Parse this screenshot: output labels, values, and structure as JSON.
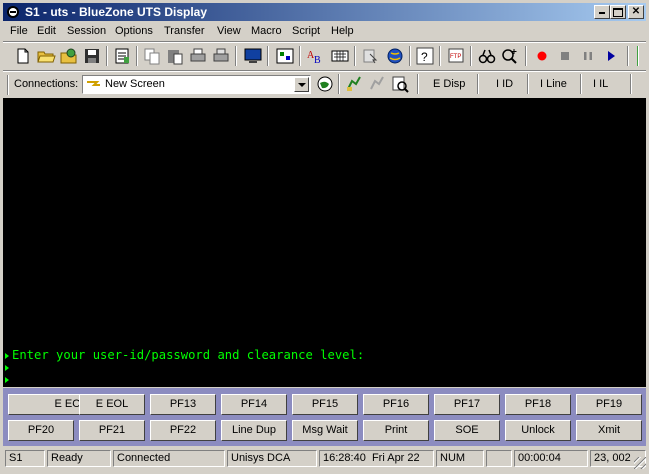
{
  "window": {
    "title": "S1 - uts - BlueZone UTS Display",
    "icon": "s1-app-icon",
    "controls": [
      "minimize-icon",
      "maximize-icon",
      "close-icon"
    ]
  },
  "menu": [
    "File",
    "Edit",
    "Session",
    "Options",
    "Transfer",
    "View",
    "Macro",
    "Script",
    "Help"
  ],
  "toolbar": {
    "icons": [
      "new-document-icon",
      "open-folder-icon",
      "settings-folder-icon",
      "save-icon",
      "notepad-icon",
      "copy-icon",
      "paste-icon",
      "print-icon",
      "print-setup-icon",
      "display-icon",
      "keyboard-map-icon",
      "font-icon",
      "keypad-icon",
      "hotspot-icon",
      "globe-icon",
      "help-icon",
      "ftp-icon",
      "binoculars-icon",
      "zoom-icon",
      "record-icon",
      "stop-icon",
      "pause-icon",
      "play-icon"
    ],
    "colors": {
      "record": "#ff0000",
      "play": "#0000a0",
      "stop": "#808080"
    }
  },
  "connections": {
    "label": "Connections:",
    "selected": "New Screen",
    "fkeys": [
      "E Disp",
      "I ID",
      "I Line",
      "I IL"
    ]
  },
  "terminal": {
    "lines": [
      "Enter your user-id/password and clearance level:",
      "",
      ""
    ],
    "text_color": "#00ff00",
    "background": "#000000"
  },
  "function_keys": {
    "row1": [
      "E EOF",
      "E EOL",
      "PF13",
      "PF14",
      "PF15",
      "PF16",
      "PF17",
      "PF18",
      "PF19"
    ],
    "row2": [
      "PF20",
      "PF21",
      "PF22",
      "Line Dup",
      "Msg Wait",
      "Print",
      "SOE",
      "Unlock",
      "Xmit"
    ],
    "panel_color": "#8c8cc0"
  },
  "status": {
    "session": "S1",
    "state": "Ready",
    "connection": "Connected",
    "host": "Unisys DCA",
    "time": "16:28:40",
    "date": "Fri Apr 22",
    "num": "NUM",
    "blank": "",
    "elapsed": "00:00:04",
    "cursor": "23, 002"
  }
}
